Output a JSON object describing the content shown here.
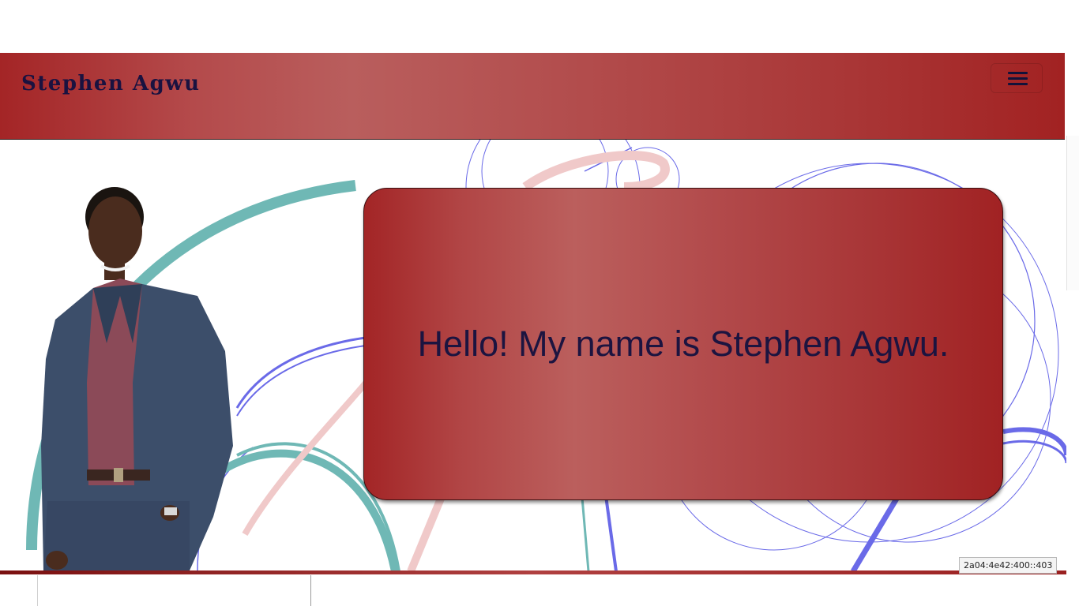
{
  "navbar": {
    "brand": "Stephen Agwu",
    "menu_icon": "hamburger-menu-icon"
  },
  "hero": {
    "greeting": "Hello! My name is Stephen Agwu.",
    "photo": "portrait-photo"
  },
  "overlay": {
    "ip_address": "2a04:4e42:400::403"
  },
  "colors": {
    "brand_red": "#a42526",
    "brand_text": "#1a1240",
    "accent_teal": "#6fb8b5",
    "accent_blue": "#6a6ae8",
    "accent_pink": "#f0c9c9"
  }
}
